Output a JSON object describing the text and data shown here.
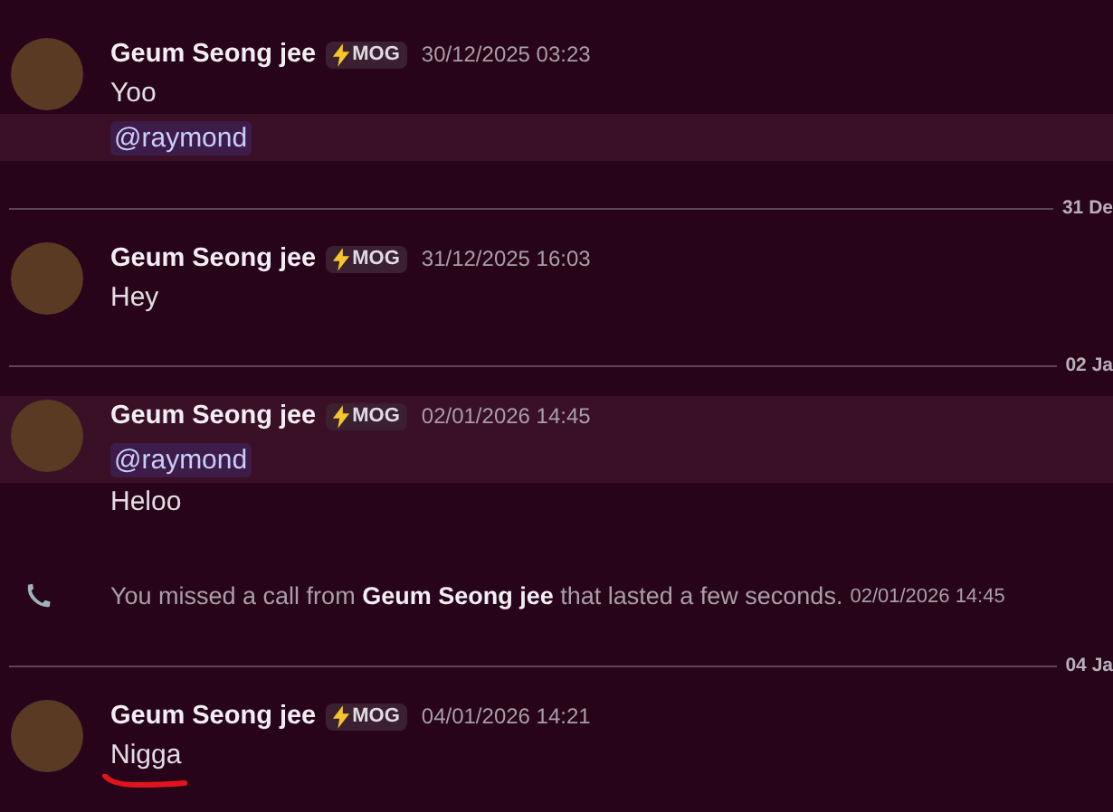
{
  "messages": [
    {
      "kind": "message",
      "author": "Geum Seong jee",
      "badge": "MOG",
      "timestamp": "30/12/2025 03:23",
      "header_highlighted": false,
      "lines": [
        {
          "kind": "text",
          "text": "Yoo",
          "highlighted": false,
          "underlined": false
        },
        {
          "kind": "mention",
          "text": "@raymond",
          "highlighted": true
        }
      ]
    },
    {
      "kind": "divider",
      "label": "31 De"
    },
    {
      "kind": "message",
      "author": "Geum Seong jee",
      "badge": "MOG",
      "timestamp": "31/12/2025 16:03",
      "header_highlighted": false,
      "lines": [
        {
          "kind": "text",
          "text": "Hey",
          "highlighted": false,
          "underlined": false
        }
      ]
    },
    {
      "kind": "divider",
      "label": "02 Ja"
    },
    {
      "kind": "message",
      "author": "Geum Seong jee",
      "badge": "MOG",
      "timestamp": "02/01/2026 14:45",
      "header_highlighted": true,
      "lines": [
        {
          "kind": "mention",
          "text": "@raymond",
          "highlighted": true
        },
        {
          "kind": "text",
          "text": "Heloo",
          "highlighted": false,
          "underlined": false
        }
      ]
    },
    {
      "kind": "call",
      "text": "You missed a call from **Geum Seong jee** that lasted a few seconds.",
      "timestamp": "02/01/2026 14:45"
    },
    {
      "kind": "divider",
      "label": "04 Ja"
    },
    {
      "kind": "message",
      "author": "Geum Seong jee",
      "badge": "MOG",
      "timestamp": "04/01/2026 14:21",
      "header_highlighted": false,
      "lines": [
        {
          "kind": "text",
          "text": "Nigga",
          "highlighted": false,
          "underlined": true
        }
      ]
    }
  ]
}
